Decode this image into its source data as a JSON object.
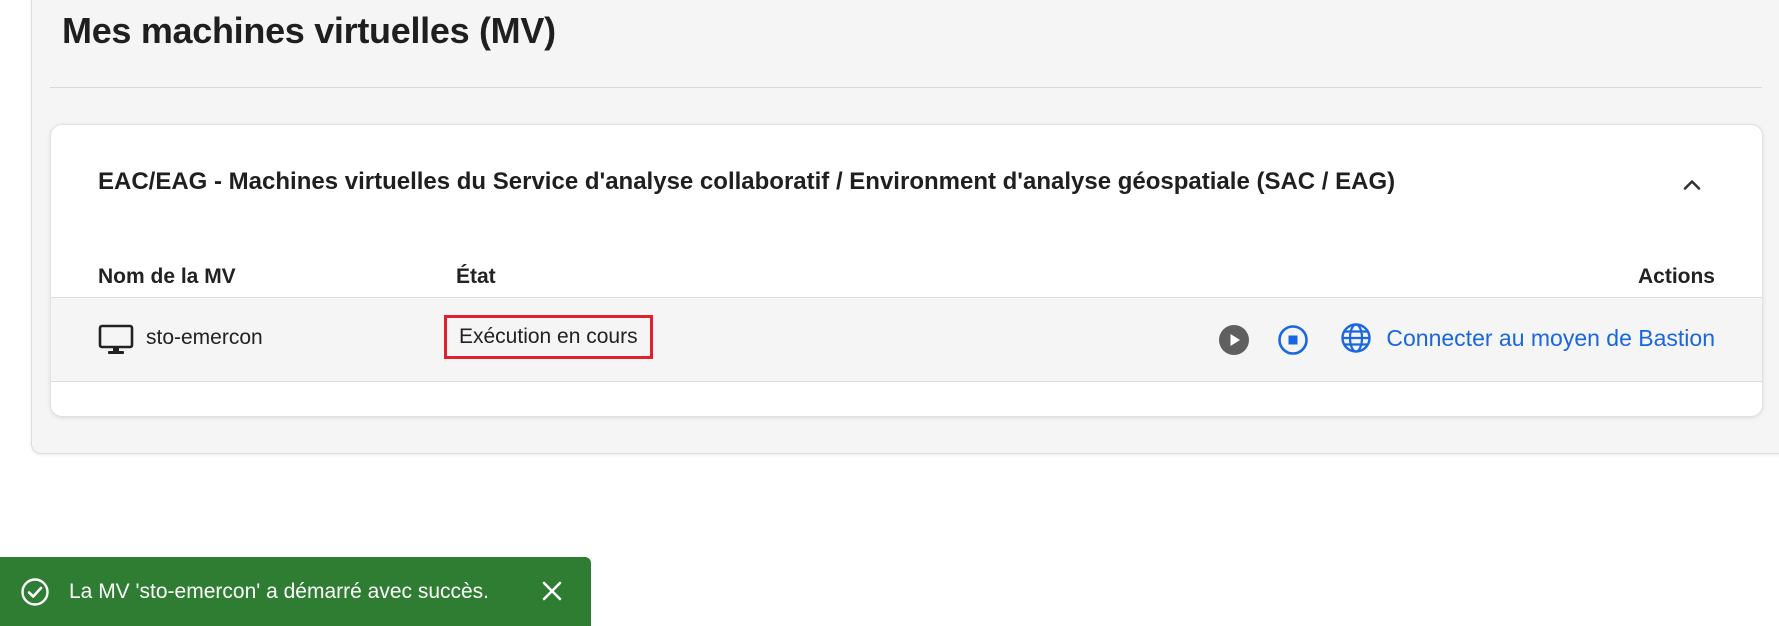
{
  "page": {
    "title": "Mes machines virtuelles (MV)"
  },
  "group": {
    "title": "EAC/EAG - Machines virtuelles du Service d'analyse collaboratif / Environment d'analyse géospatiale (SAC / EAG)",
    "expanded": true,
    "collapse_icon": "chevron-up-icon"
  },
  "table": {
    "columns": {
      "name": "Nom de la MV",
      "state": "État",
      "actions": "Actions"
    },
    "rows": [
      {
        "icon": "monitor-icon",
        "name": "sto-emercon",
        "state": "Exécution en cours",
        "actions": {
          "start_icon": "play-circle-icon",
          "stop_icon": "stop-circle-icon",
          "connect_icon": "globe-icon",
          "connect_label": "Connecter au moyen de Bastion"
        }
      }
    ]
  },
  "toast": {
    "icon": "check-circle-icon",
    "message": "La MV 'sto-emercon' a démarré avec succès.",
    "close_icon": "close-icon"
  },
  "colors": {
    "accent_blue": "#1a66e0",
    "toast_green": "#2e7d32",
    "highlight_red": "#e0202a",
    "play_gray": "#5f5f5f"
  }
}
